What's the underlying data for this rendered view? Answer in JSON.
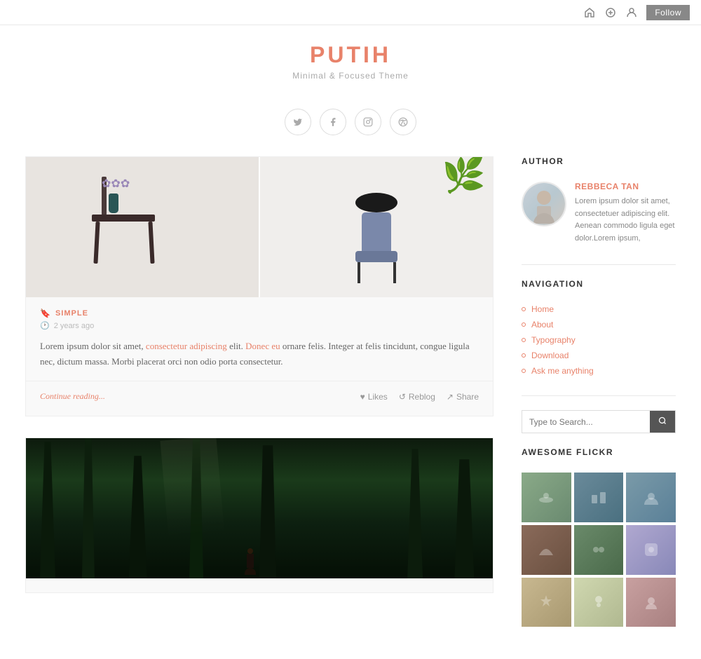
{
  "topbar": {
    "follow_label": "Follow",
    "icons": [
      "home-icon",
      "add-icon",
      "user-icon"
    ]
  },
  "header": {
    "title": "PUTIH",
    "tagline": "Minimal & Focused Theme"
  },
  "social": {
    "icons": [
      {
        "name": "twitter-icon",
        "symbol": "𝕏"
      },
      {
        "name": "facebook-icon",
        "symbol": "f"
      },
      {
        "name": "instagram-icon",
        "symbol": "◻"
      },
      {
        "name": "pinterest-icon",
        "symbol": "⊕"
      }
    ]
  },
  "post1": {
    "category": "SIMPLE",
    "meta": "2 years ago",
    "excerpt_start": "Lorem ipsum dolor sit amet,",
    "link1_text": "consectetur adipiscing",
    "excerpt_mid": " elit.",
    "link2_text": "Donec eu",
    "excerpt_end": " ornare felis. Integer at felis tincidunt, congue ligula nec, dictum massa. Morbi placerat orci non odio porta consectetur.",
    "continue_label": "Continue reading...",
    "likes_label": "Likes",
    "reblog_label": "Reblog",
    "share_label": "Share"
  },
  "sidebar": {
    "author_section_title": "AUTHOR",
    "author_name": "REBBECA TAN",
    "author_bio": "Lorem ipsum dolor sit amet, consectetuer adipiscing elit. Aenean commodo ligula eget dolor.Lorem ipsum,",
    "navigation_title": "NAVIGATION",
    "nav_items": [
      {
        "label": "Home"
      },
      {
        "label": "About"
      },
      {
        "label": "Typography"
      },
      {
        "label": "Download"
      },
      {
        "label": "Ask me anything"
      }
    ],
    "search_placeholder": "Type to Search...",
    "flickr_title": "AWESOME FLICKR"
  }
}
